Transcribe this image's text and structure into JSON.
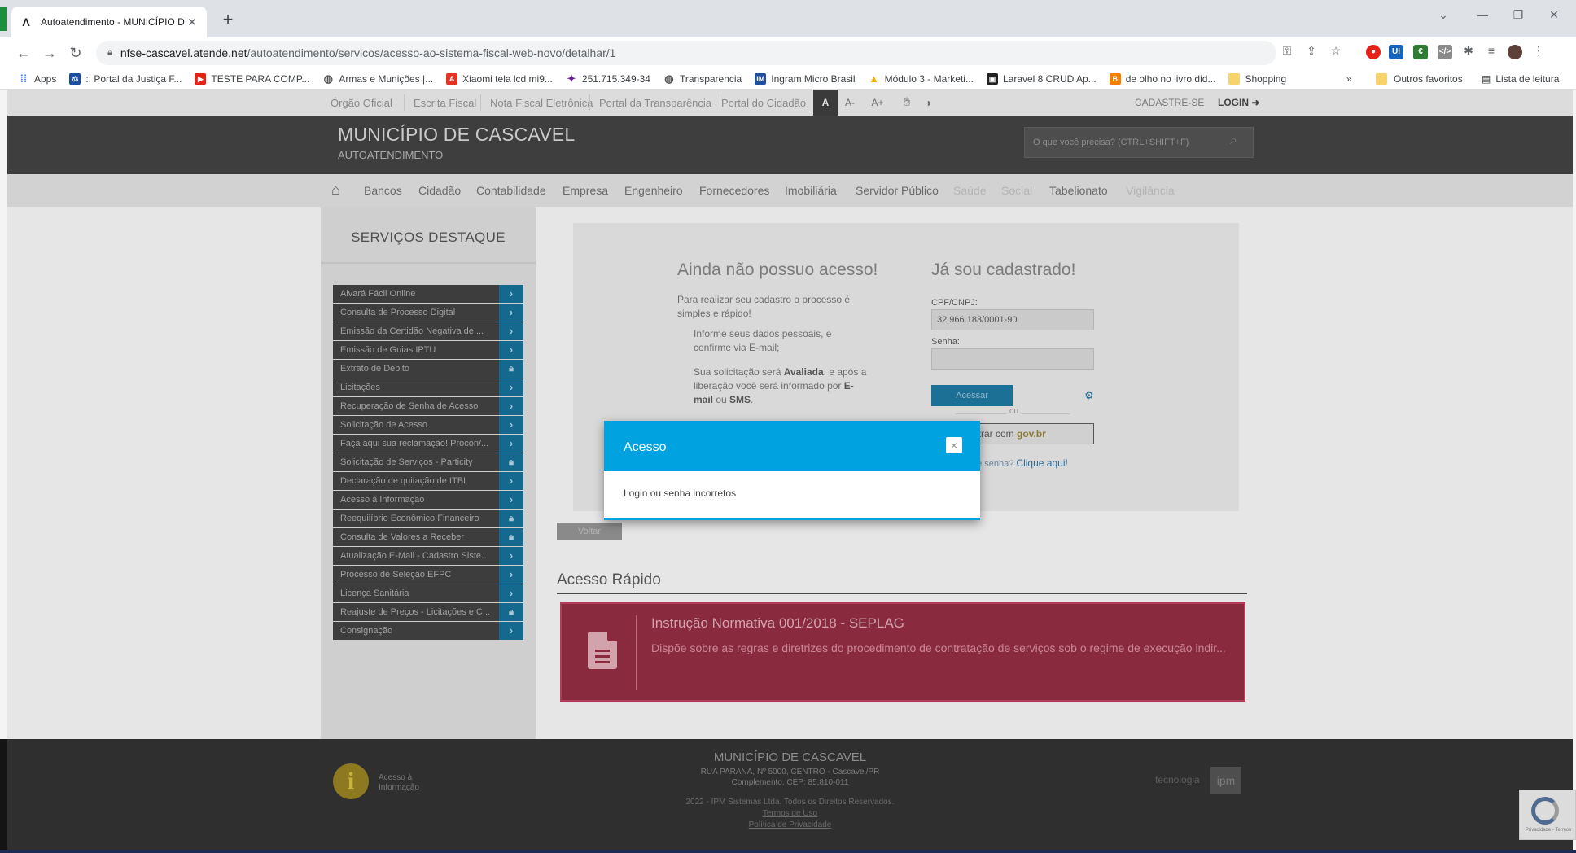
{
  "browser": {
    "tab_title": "Autoatendimento - MUNICÍPIO D",
    "url_host": "nfse-cascavel.atende.net",
    "url_path": "/autoatendimento/servicos/acesso-ao-sistema-fiscal-web-novo/detalhar/1",
    "bookmarks": [
      {
        "label": "Apps",
        "icon": "apps-grid-icon",
        "color": "#4285f4"
      },
      {
        "label": ":: Portal da Justiça F...",
        "icon": "justice-icon",
        "color": "#1a4fa0"
      },
      {
        "label": "TESTE PARA COMP...",
        "icon": "youtube-icon",
        "color": "#e62117"
      },
      {
        "label": "Armas e Munições |...",
        "icon": "globe-icon",
        "color": "#555555"
      },
      {
        "label": "Xiaomi tela lcd mi9...",
        "icon": "aliexpress-icon",
        "color": "#e43225"
      },
      {
        "label": "251.715.349-34",
        "icon": "figure-icon",
        "color": "#6a1b9a"
      },
      {
        "label": "Transparencia",
        "icon": "globe-icon",
        "color": "#555555"
      },
      {
        "label": "Ingram Micro Brasil",
        "icon": "ingram-icon",
        "color": "#1f4ea0"
      },
      {
        "label": "Módulo 3 - Marketi...",
        "icon": "drive-icon",
        "color": "#f4b400"
      },
      {
        "label": "Laravel 8 CRUD Ap...",
        "icon": "laravel-icon",
        "color": "#222222"
      },
      {
        "label": "de olho no livro did...",
        "icon": "blogger-icon",
        "color": "#f57d00"
      },
      {
        "label": "Shopping",
        "icon": "folder-icon",
        "color": "#f6d36b"
      }
    ],
    "bookmarks_more": "»",
    "other_favorites": "Outros favoritos",
    "reading_list": "Lista de leitura"
  },
  "site": {
    "top_links": [
      "Órgão Oficial",
      "Escrita Fiscal",
      "Nota Fiscal Eletrônica",
      "Portal da Transparência",
      "Portal do Cidadão"
    ],
    "font_buttons": [
      "A",
      "A-",
      "A+"
    ],
    "cadastre": "CADASTRE-SE",
    "login": "LOGIN",
    "brand_title": "MUNICÍPIO DE CASCAVEL",
    "brand_subtitle": "AUTOATENDIMENTO",
    "search_placeholder": "O que você precisa? (CTRL+SHIFT+F)",
    "categories": [
      {
        "label": "Bancos",
        "enabled": true
      },
      {
        "label": "Cidadão",
        "enabled": true
      },
      {
        "label": "Contabilidade",
        "enabled": true
      },
      {
        "label": "Empresa",
        "enabled": true
      },
      {
        "label": "Engenheiro",
        "enabled": true
      },
      {
        "label": "Fornecedores",
        "enabled": true
      },
      {
        "label": "Imobiliária",
        "enabled": true
      },
      {
        "label": "Servidor Público",
        "enabled": true
      },
      {
        "label": "Saúde",
        "enabled": false
      },
      {
        "label": "Social",
        "enabled": false
      },
      {
        "label": "Tabelionato",
        "enabled": true
      },
      {
        "label": "Vigilância",
        "enabled": false
      }
    ]
  },
  "sidebar": {
    "title": "SERVIÇOS DESTAQUE",
    "items": [
      {
        "label": "Alvará Fácil Online",
        "locked": false
      },
      {
        "label": "Consulta de Processo Digital",
        "locked": false
      },
      {
        "label": "Emissão da Certidão Negativa de ...",
        "locked": false
      },
      {
        "label": "Emissão de Guias IPTU",
        "locked": false
      },
      {
        "label": "Extrato de Débito",
        "locked": true
      },
      {
        "label": "Licitações",
        "locked": false
      },
      {
        "label": "Recuperação de Senha de Acesso",
        "locked": false
      },
      {
        "label": "Solicitação de Acesso",
        "locked": false
      },
      {
        "label": "Faça aqui sua reclamação! Procon/...",
        "locked": false
      },
      {
        "label": "Solicitação de Serviços - Particity",
        "locked": true
      },
      {
        "label": "Declaração de quitação de ITBI",
        "locked": false
      },
      {
        "label": "Acesso à Informação",
        "locked": false
      },
      {
        "label": "Reequilíbrio Econômico Financeiro",
        "locked": true
      },
      {
        "label": "Consulta de Valores a Receber",
        "locked": true
      },
      {
        "label": "Atualização E-Mail - Cadastro Siste...",
        "locked": false
      },
      {
        "label": "Processo de Seleção EFPC",
        "locked": false
      },
      {
        "label": "Licença Sanitária",
        "locked": false
      },
      {
        "label": "Reajuste de Preços - Licitações e C...",
        "locked": true
      },
      {
        "label": "Consignação",
        "locked": false
      }
    ]
  },
  "login_panel": {
    "left_title": "Ainda não possuo acesso!",
    "left_intro": "Para realizar seu cadastro o processo é simples e rápido!",
    "left_item1": "Informe seus dados pessoais, e confirme via E-mail;",
    "left_item2_a": "Sua solicitação será ",
    "left_item2_b": "Avaliada",
    "left_item2_c": ", e após a liberação você será informado por ",
    "left_item2_d": "E-mail",
    "left_item2_e": " ou ",
    "left_item2_f": "SMS",
    "left_item2_g": ".",
    "right_title": "Já sou cadastrado!",
    "cpf_label": "CPF/CNPJ:",
    "cpf_value": "32.966.183/0001-90",
    "senha_label": "Senha:",
    "senha_value": "",
    "acessar": "Acessar",
    "ou": "ou",
    "govbr_prefix": "ntrar com ",
    "govbr_brand": "gov.br",
    "forgot_prefix": "ue senha? ",
    "forgot_link": "Clique aqui!",
    "voltar": "Voltar"
  },
  "quick_access": {
    "title": "Acesso Rápido",
    "card_title": "Instrução Normativa 001/2018 - SEPLAG",
    "card_desc": "Dispõe sobre as regras e diretrizes do procedimento de contratação de serviços sob o regime de execução indir..."
  },
  "footer": {
    "title": "MUNICÍPIO DE CASCAVEL",
    "address1": "RUA PARANA, Nº 5000, CENTRO - Cascavel/PR",
    "address2": "Complemento, CEP: 85.810-011",
    "copyright": "2022 - IPM Sistemas Ltda. Todos os Direitos Reservados.",
    "terms": "Termos de Uso",
    "privacy": "Política de Privacidade",
    "info_line1": "Acesso à",
    "info_line2": "Informação",
    "tecnologia": "tecnologia",
    "ipm": "ipm",
    "recaptcha": "Privacidade - Termos"
  },
  "modal": {
    "title": "Acesso",
    "message": "Login ou senha incorretos",
    "close": "×",
    "accent": "#00a3e0"
  }
}
